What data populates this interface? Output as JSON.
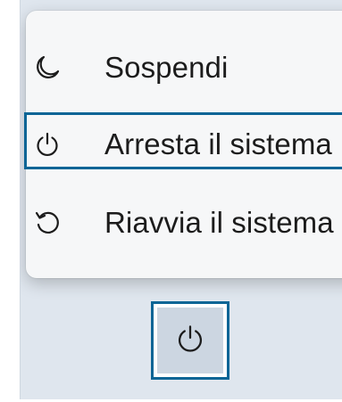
{
  "power_menu": {
    "items": [
      {
        "label": "Sospendi",
        "icon": "moon-icon"
      },
      {
        "label": "Arresta il sistema",
        "icon": "power-icon"
      },
      {
        "label": "Riavvia il sistema",
        "icon": "restart-icon"
      }
    ],
    "focused_index": 1
  },
  "taskbar": {
    "power_button_icon": "power-icon"
  },
  "colors": {
    "focus": "#0a6596",
    "menu_bg": "#f6f7f8",
    "screen_bg": "#dfe6ee",
    "text": "#1c1c1c"
  }
}
